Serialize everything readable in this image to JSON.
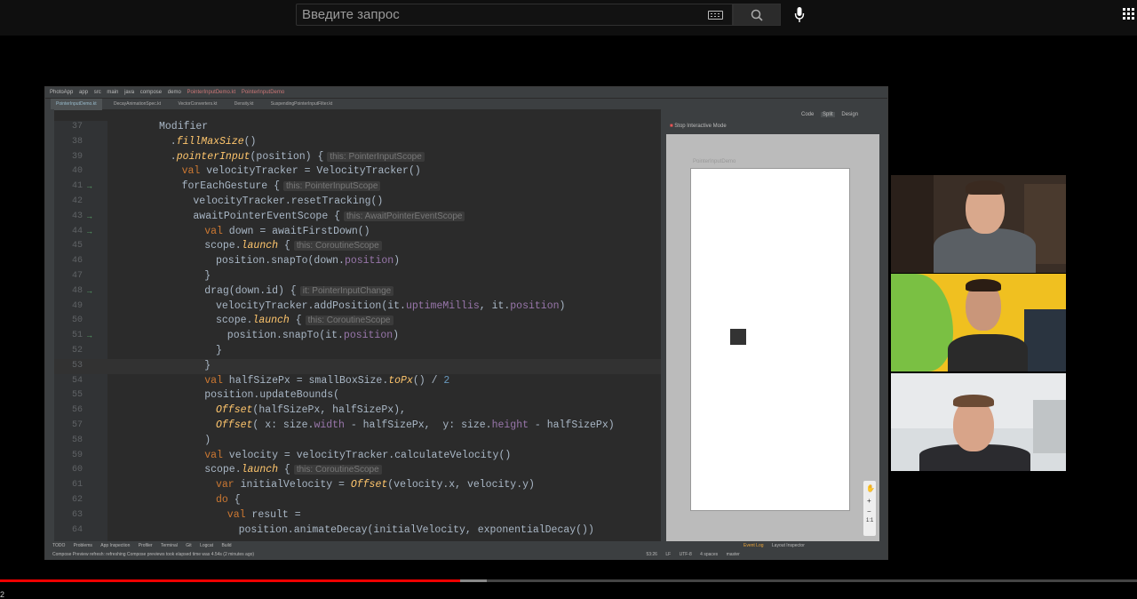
{
  "search": {
    "placeholder": "Введите запрос",
    "keyboard_icon": "keyboard-icon",
    "search_icon": "search-icon",
    "mic_icon": "microphone-icon",
    "apps_icon": "apps-grid-icon"
  },
  "ide": {
    "breadcrumb": [
      "PhotoApp",
      "app",
      "src",
      "main",
      "java",
      "compose",
      "demo",
      "PointerInputDemo.kt",
      "PointerInputDemo"
    ],
    "tabs": [
      "PointerInputDemo.kt",
      "DecayAnimationSpec.kt",
      "VectorConverters.kt",
      "Density.kt",
      "SuspendingPointerInputFilter.kt"
    ],
    "view_modes": [
      "Code",
      "Split",
      "Design"
    ],
    "preview_header": "Stop Interactive Mode",
    "preview_label": "PointerInputDemo",
    "code_lines": [
      {
        "n": "37",
        "text": "Modifier"
      },
      {
        "n": "38",
        "text": ".fillMaxSize()"
      },
      {
        "n": "39",
        "text": ".pointerInput(position) {",
        "hint": "this: PointerInputScope"
      },
      {
        "n": "40",
        "text": "val velocityTracker = VelocityTracker()"
      },
      {
        "n": "41",
        "text": "forEachGesture {",
        "hint": "this: PointerInputScope"
      },
      {
        "n": "42",
        "text": "velocityTracker.resetTracking()"
      },
      {
        "n": "43",
        "text": "awaitPointerEventScope {",
        "hint": "this: AwaitPointerEventScope"
      },
      {
        "n": "44",
        "text": "val down = awaitFirstDown()"
      },
      {
        "n": "45",
        "text": "scope.launch {",
        "hint": "this: CoroutineScope"
      },
      {
        "n": "46",
        "text": "position.snapTo(down.position)"
      },
      {
        "n": "47",
        "text": "}"
      },
      {
        "n": "48",
        "text": "drag(down.id) {",
        "hint": "it: PointerInputChange"
      },
      {
        "n": "49",
        "text": "velocityTracker.addPosition(it.uptimeMillis, it.position)"
      },
      {
        "n": "50",
        "text": "scope.launch {",
        "hint": "this: CoroutineScope"
      },
      {
        "n": "51",
        "text": "position.snapTo(it.position)"
      },
      {
        "n": "52",
        "text": "}"
      },
      {
        "n": "53",
        "text": "}"
      },
      {
        "n": "54",
        "text": "val halfSizePx = smallBoxSize.toPx() / 2"
      },
      {
        "n": "55",
        "text": "position.updateBounds("
      },
      {
        "n": "56",
        "text": "Offset(halfSizePx, halfSizePx),"
      },
      {
        "n": "57",
        "text": "Offset( x: size.width - halfSizePx,  y: size.height - halfSizePx)"
      },
      {
        "n": "58",
        "text": ")"
      },
      {
        "n": "59",
        "text": "val velocity = velocityTracker.calculateVelocity()"
      },
      {
        "n": "60",
        "text": "scope.launch {",
        "hint": "this: CoroutineScope"
      },
      {
        "n": "61",
        "text": "var initialVelocity = Offset(velocity.x, velocity.y)"
      },
      {
        "n": "62",
        "text": "do {"
      },
      {
        "n": "63",
        "text": "val result ="
      },
      {
        "n": "64",
        "text": "position.animateDecay(initialVelocity, exponentialDecay())"
      }
    ],
    "tool_windows": [
      "TODO",
      "Problems",
      "App Inspection",
      "Profiler",
      "Terminal",
      "Git",
      "Logcat",
      "Build"
    ],
    "right_tools": [
      "Event Log",
      "Layout Inspector"
    ],
    "status_message": "Compose Preview refresh: refreshing Compose previews took elapsed time was 4.54s (2 minutes ago)",
    "status_right": [
      "53:26",
      "LF",
      "UTF-8",
      "4 spaces",
      "master"
    ]
  },
  "player": {
    "played_fraction": 0.405,
    "buffered_fraction": 0.428,
    "time_fragment": "2"
  },
  "colors": {
    "topbar": "#0f0f0f",
    "ide_bg": "#2b2b2b",
    "keyword": "#cc7832",
    "function": "#ffc66d",
    "property": "#9876aa",
    "progress_played": "#ee0000"
  }
}
